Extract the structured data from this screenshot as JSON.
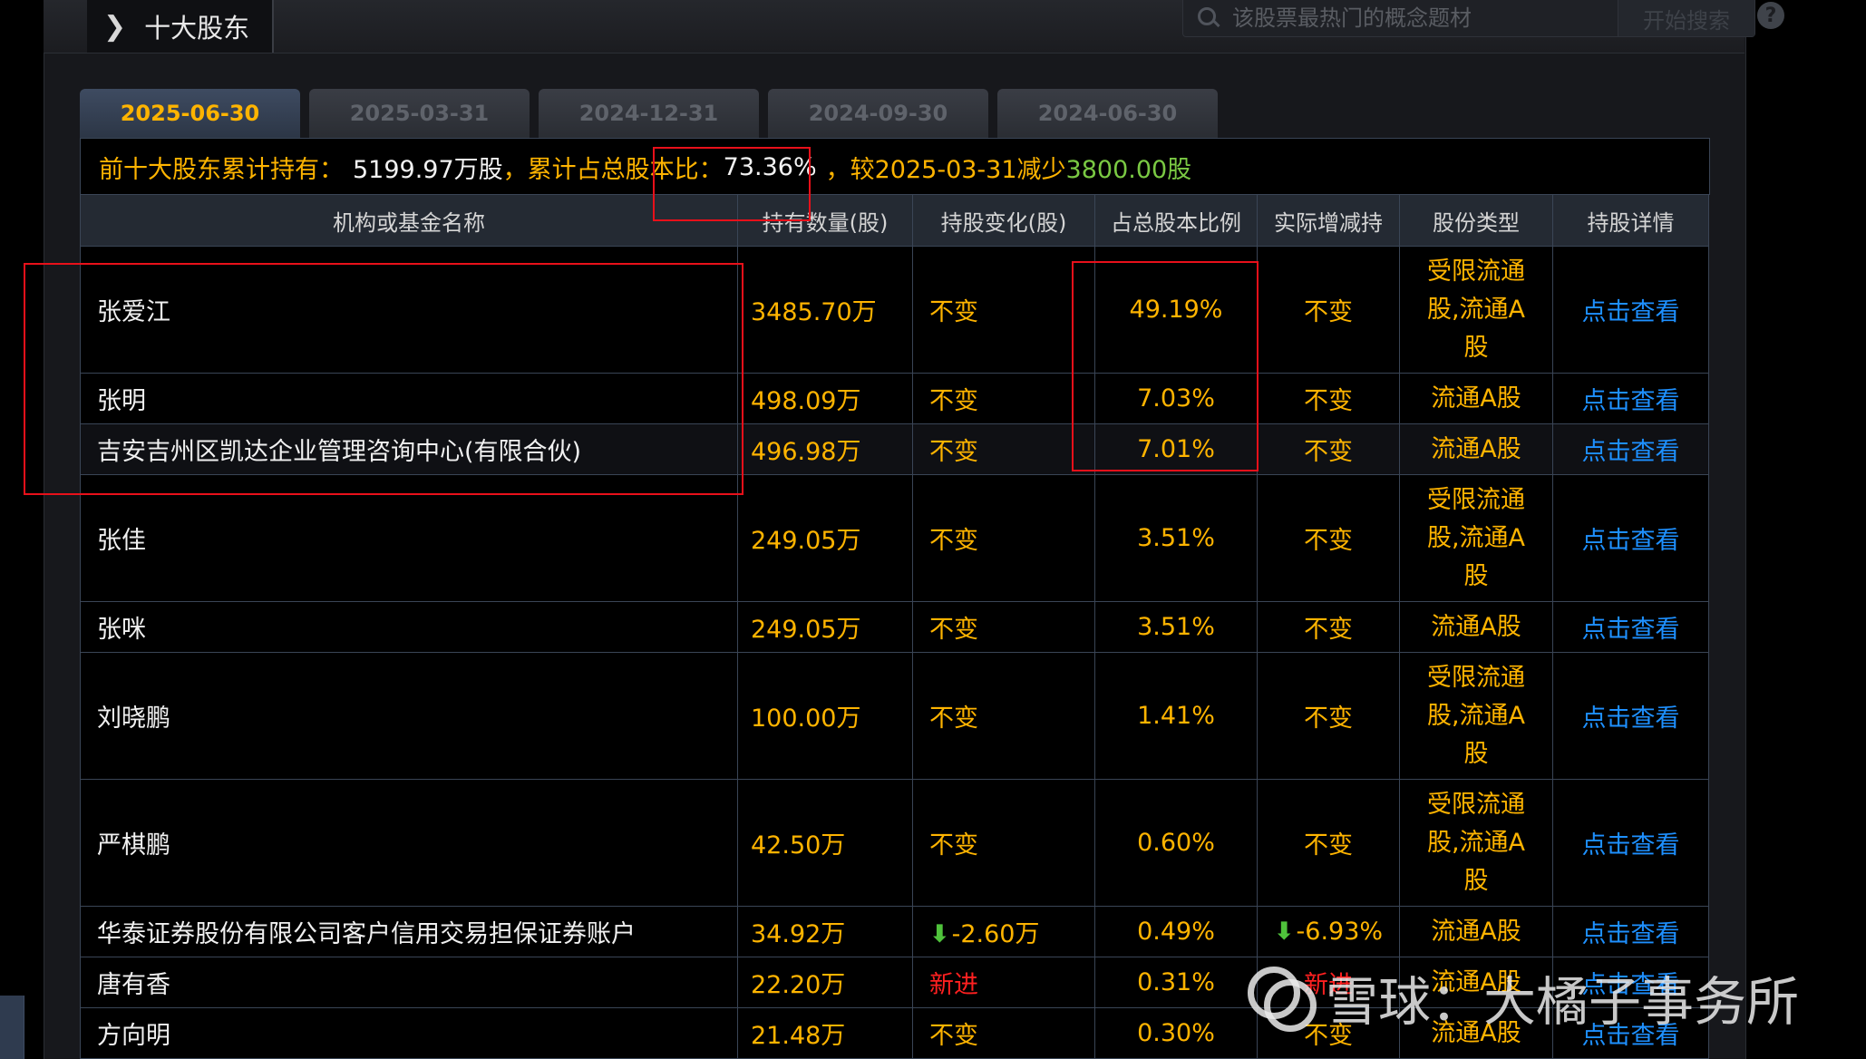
{
  "header": {
    "title": "十大股东",
    "search_placeholder": "该股票最热门的概念题材",
    "search_button": "开始搜索",
    "help": "?"
  },
  "tabs": [
    "2025-06-30",
    "2025-03-31",
    "2024-12-31",
    "2024-09-30",
    "2024-06-30"
  ],
  "summary": {
    "label1": "前十大股东累计持有：",
    "total_shares": "5199.97万股",
    "label2": "，累计占总股本比：",
    "ratio": "73.36%",
    "label3": "，较2025-03-31减少",
    "change": "3800.00股"
  },
  "columns": [
    "机构或基金名称",
    "持有数量(股)",
    "持股变化(股)",
    "占总股本比例",
    "实际增减持",
    "股份类型",
    "持股详情"
  ],
  "rows": [
    {
      "name": "张爱江",
      "qty": "3485.70万",
      "chg": "不变",
      "pct": "49.19%",
      "inc": "不变",
      "type": "受限流通股,流通A股",
      "detail": "点击查看"
    },
    {
      "name": "张明",
      "qty": "498.09万",
      "chg": "不变",
      "pct": "7.03%",
      "inc": "不变",
      "type": "流通A股",
      "detail": "点击查看"
    },
    {
      "name": "吉安吉州区凯达企业管理咨询中心(有限合伙)",
      "qty": "496.98万",
      "chg": "不变",
      "pct": "7.01%",
      "inc": "不变",
      "type": "流通A股",
      "detail": "点击查看"
    },
    {
      "name": "张佳",
      "qty": "249.05万",
      "chg": "不变",
      "pct": "3.51%",
      "inc": "不变",
      "type": "受限流通股,流通A股",
      "detail": "点击查看"
    },
    {
      "name": "张咪",
      "qty": "249.05万",
      "chg": "不变",
      "pct": "3.51%",
      "inc": "不变",
      "type": "流通A股",
      "detail": "点击查看"
    },
    {
      "name": "刘晓鹏",
      "qty": "100.00万",
      "chg": "不变",
      "pct": "1.41%",
      "inc": "不变",
      "type": "受限流通股,流通A股",
      "detail": "点击查看"
    },
    {
      "name": "严棋鹏",
      "qty": "42.50万",
      "chg": "不变",
      "pct": "0.60%",
      "inc": "不变",
      "type": "受限流通股,流通A股",
      "detail": "点击查看"
    },
    {
      "name": "华泰证券股份有限公司客户信用交易担保证券账户",
      "qty": "34.92万",
      "chg": "-2.60万",
      "pct": "0.49%",
      "inc": "-6.93%",
      "type": "流通A股",
      "detail": "点击查看"
    },
    {
      "name": "唐有香",
      "qty": "22.20万",
      "chg": "新进",
      "pct": "0.31%",
      "inc": "新进",
      "type": "流通A股",
      "detail": "点击查看"
    },
    {
      "name": "方向明",
      "qty": "21.48万",
      "chg": "不变",
      "pct": "0.30%",
      "inc": "不变",
      "type": "流通A股",
      "detail": "点击查看"
    }
  ],
  "watermark": "雪球：大橘子事务所",
  "colors": {
    "accent": "#ffb400",
    "link": "#1e90ff",
    "down": "#4fc23b",
    "new": "#ff2020",
    "highlight": "#e8101a"
  }
}
